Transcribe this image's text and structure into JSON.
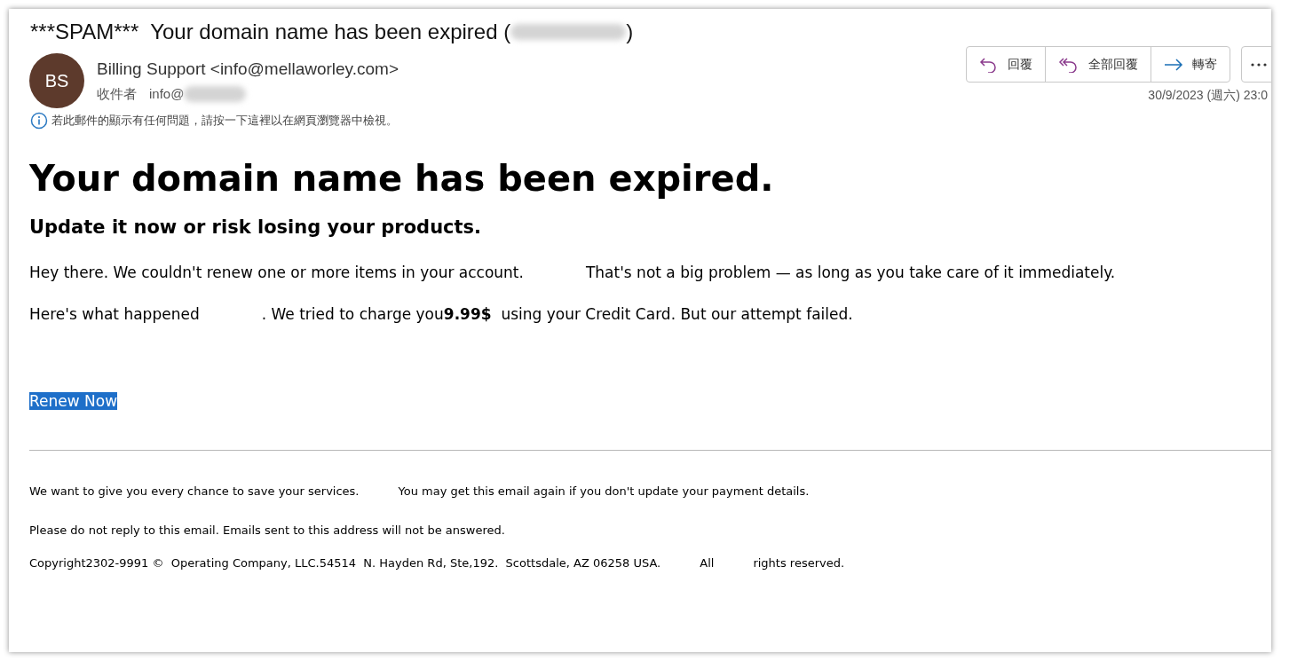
{
  "subject": {
    "text": "***SPAM***  Your domain name has been expired (",
    "close": ")"
  },
  "sender": {
    "initials": "BS",
    "name": "Billing Support <info@mellaworley.com>",
    "to_label": "收件者",
    "to_value": "info@"
  },
  "actions": [
    {
      "kind": "reply",
      "label": "回覆"
    },
    {
      "kind": "reply_all",
      "label": "全部回覆"
    },
    {
      "kind": "forward",
      "label": "轉寄"
    },
    {
      "kind": "more"
    }
  ],
  "date": "30/9/2023 (週六) 23:0",
  "info_bar": "若此郵件的顯示有任何問題，請按一下這裡以在網頁瀏覽器中檢視。",
  "body": {
    "heading": "Your domain name has been expired.",
    "subheading": "Update it now or risk losing your products.",
    "lines": [
      [
        "Hey there. We couldn't renew one or more items in your account.",
        "That's not a big problem — as long as you take care of it immediately."
      ],
      [
        "Here's what happened",
        ". We tried to charge you**9.99$**  using your Credit Card. But our attempt failed."
      ]
    ],
    "link": {
      "label": "Renew Now",
      "selected": true
    }
  },
  "footer": [
    [
      "We want to give you every chance to save your services.",
      "You may get this email again if you don't update your payment details."
    ],
    [
      "Please do not reply to this email. Emails sent to this address will not be answered."
    ],
    [
      "Copyright2302-9991 ©  Operating Company, LLC.54514  N. Hayden Rd, Ste,192.  Scottsdale, AZ 06258 USA.",
      "All",
      "rights reserved."
    ]
  ]
}
